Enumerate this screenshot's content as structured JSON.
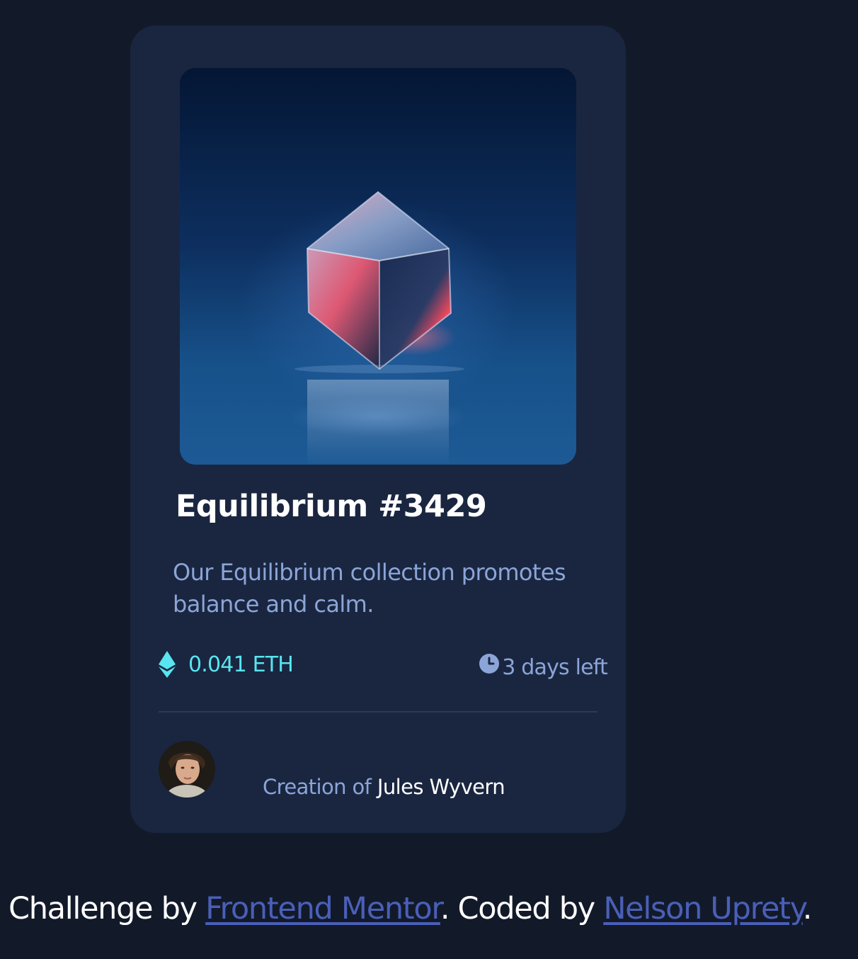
{
  "card": {
    "title": "Equilibrium #3429",
    "description": "Our Equilibrium collection promotes balance and calm.",
    "price": "0.041 ETH",
    "time_left": "3 days left",
    "creator_label": "Creation of",
    "creator_name": "Jules Wyvern"
  },
  "attribution": {
    "challenge_prefix": "Challenge by ",
    "challenge_link": "Frontend Mentor",
    "coded_prefix": ". Coded by ",
    "coded_link": "Nelson Uprety",
    "suffix": "."
  },
  "icons": {
    "price": "ethereum-icon",
    "time": "clock-icon"
  },
  "colors": {
    "page_background": "#121a2a",
    "card_background": "#1a2640",
    "accent_cyan": "#58e5ef",
    "soft_blue": "#8ba5d8",
    "link_blue": "#4a5fb8",
    "white": "#ffffff"
  }
}
